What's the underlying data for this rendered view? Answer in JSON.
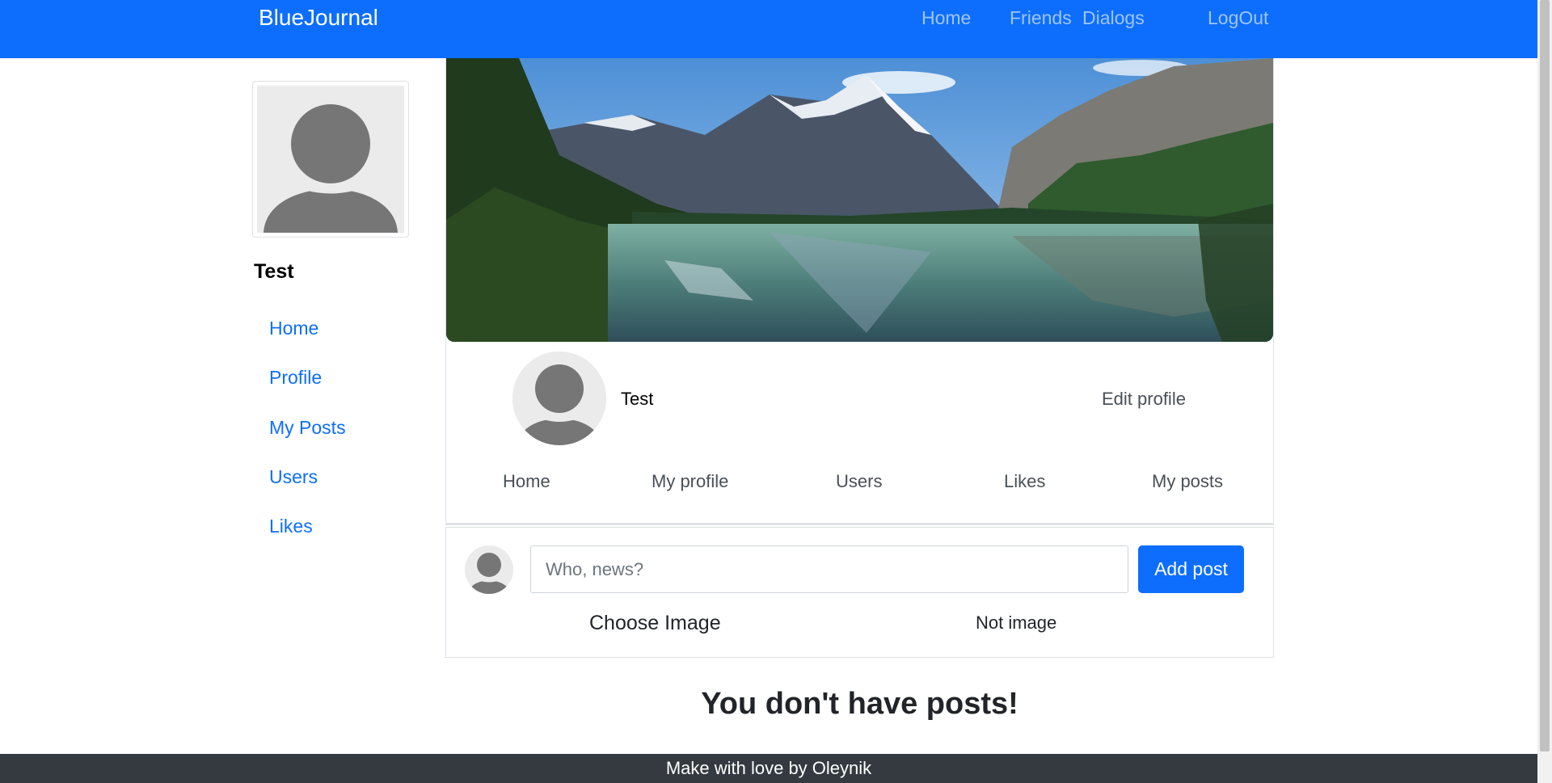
{
  "navbar": {
    "brand": "BlueJournal",
    "links": [
      "Home",
      "Friends",
      "Dialogs",
      "LogOut"
    ]
  },
  "sidebar": {
    "user_name": "Test",
    "links": [
      "Home",
      "Profile",
      "My Posts",
      "Users",
      "Likes"
    ]
  },
  "profile": {
    "name": "Test",
    "edit_label": "Edit profile",
    "tabs": [
      "Home",
      "My profile",
      "Users",
      "Likes",
      "My posts"
    ]
  },
  "composer": {
    "placeholder": "Who, news?",
    "value": "",
    "add_label": "Add post",
    "choose_image_label": "Choose Image",
    "image_status": "Not image"
  },
  "empty_message": "You don't have posts!",
  "footer": {
    "text": "Make with love by Oleynik"
  },
  "colors": {
    "primary": "#0d6efd",
    "footer_bg": "#343a40",
    "avatar_bg": "#ebebeb",
    "avatar_fg": "#767676"
  },
  "icons": {
    "avatar": "user-silhouette-icon"
  }
}
